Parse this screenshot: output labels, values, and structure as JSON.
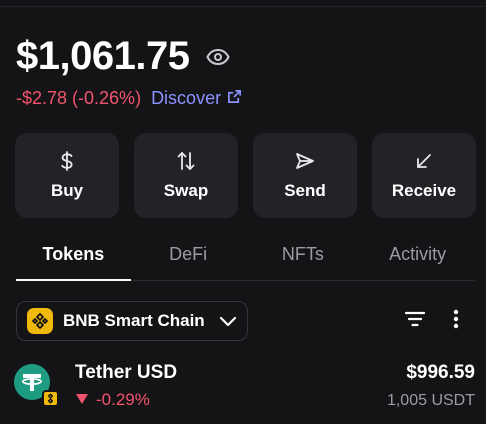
{
  "wallet": {
    "balance": "$1,061.75",
    "change": "-$2.78 (-0.26%)",
    "discover_label": "Discover"
  },
  "actions": [
    {
      "label": "Buy",
      "icon": "dollar-icon"
    },
    {
      "label": "Swap",
      "icon": "swap-arrows-icon"
    },
    {
      "label": "Send",
      "icon": "send-icon"
    },
    {
      "label": "Receive",
      "icon": "receive-arrow-icon"
    }
  ],
  "tabs": [
    {
      "label": "Tokens",
      "active": true
    },
    {
      "label": "DeFi",
      "active": false
    },
    {
      "label": "NFTs",
      "active": false
    },
    {
      "label": "Activity",
      "active": false
    }
  ],
  "chain_selector": {
    "selected": "BNB Smart Chain"
  },
  "tokens": [
    {
      "name": "Tether USD",
      "change": "-0.29%",
      "value": "$996.59",
      "amount": "1,005 USDT"
    }
  ],
  "colors": {
    "background": "#141416",
    "card": "#222327",
    "negative": "#f0546e",
    "link": "#8b93ff",
    "bnb": "#f0b90b",
    "tether": "#1d9c82"
  }
}
